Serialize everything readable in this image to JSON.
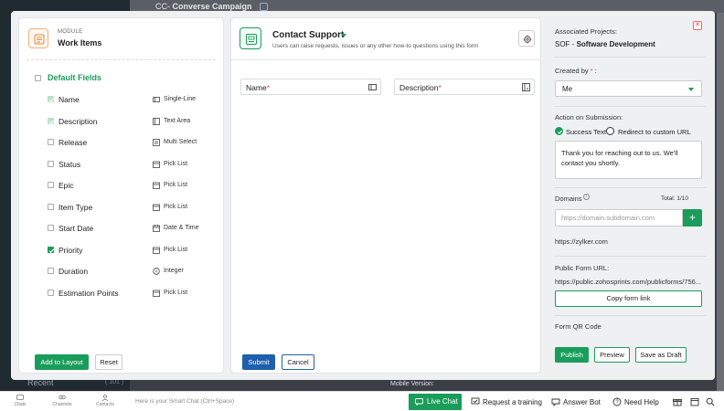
{
  "background": {
    "breadcrumb_prefix": "CC-",
    "breadcrumb_title": "Converse Campaign",
    "recent_label": "Recent",
    "recent_count": "( 101 )",
    "mobile_version": "Mobile Version:"
  },
  "module": {
    "label": "MODULE",
    "title": "Work Items",
    "default_fields_label": "Default Fields",
    "fields": [
      {
        "name": "Name",
        "type": "Single-Line",
        "state": "checked-light",
        "icon": "single-line-icon"
      },
      {
        "name": "Description",
        "type": "Text Area",
        "state": "checked-light",
        "icon": "text-area-icon"
      },
      {
        "name": "Release",
        "type": "Multi Select",
        "state": "unchecked",
        "icon": "multi-select-icon"
      },
      {
        "name": "Status",
        "type": "Pick List",
        "state": "unchecked",
        "icon": "pick-list-icon"
      },
      {
        "name": "Epic",
        "type": "Pick List",
        "state": "unchecked",
        "icon": "pick-list-icon"
      },
      {
        "name": "Item Type",
        "type": "Pick List",
        "state": "unchecked",
        "icon": "pick-list-icon"
      },
      {
        "name": "Start Date",
        "type": "Date & Time",
        "state": "unchecked",
        "icon": "date-time-icon"
      },
      {
        "name": "Priority",
        "type": "Pick List",
        "state": "checked",
        "icon": "pick-list-icon"
      },
      {
        "name": "Duration",
        "type": "Integer",
        "state": "unchecked",
        "icon": "integer-icon"
      },
      {
        "name": "Estimation Points",
        "type": "Pick List",
        "state": "unchecked",
        "icon": "pick-list-icon"
      }
    ],
    "add_to_layout_label": "Add to Layout",
    "reset_label": "Reset"
  },
  "form": {
    "title": "Contact Support",
    "subtitle": "Users can raise requests, issues or any other how-to questions using this form",
    "fields": [
      {
        "label": "Name",
        "required": "*"
      },
      {
        "label": "Description",
        "required": "*"
      }
    ],
    "submit_label": "Submit",
    "cancel_label": "Cancel"
  },
  "settings": {
    "associated_projects_label": "Associated Projects:",
    "project_code": "SOF",
    "project_separator": " - ",
    "project_name": "Software Development",
    "created_by_label": "Created by",
    "created_by_required": "*",
    "created_by_suffix": " :",
    "created_by_value": "Me",
    "action_label": "Action on Submission:",
    "option_success": "Success Text",
    "option_redirect": "Redirect to custom URL",
    "success_message": "Thank you for reaching out to us. We'll contact you shortly.",
    "domains_label": "Domains",
    "domains_total": "Total: 1/10",
    "domain_placeholder": "https://domain.subdomain.com",
    "domain_added": "https://zylker.com",
    "public_url_label": "Public Form URL:",
    "public_url": "https://public.zohosprints.com/publicforms/756...",
    "copy_link_label": "Copy form link",
    "qr_label": "Form QR Code",
    "publish_label": "Publish",
    "preview_label": "Preview",
    "save_draft_label": "Save as Draft"
  },
  "bottom_bar": {
    "nav": [
      {
        "label": "Chats"
      },
      {
        "label": "Channels"
      },
      {
        "label": "Contacts"
      }
    ],
    "smart_chat_placeholder": "Here is your Smart Chat (Ctrl+Space)",
    "live_chat": "Live Chat",
    "request_training": "Request a training",
    "answer_bot": "Answer Bot",
    "need_help": "Need Help"
  },
  "colors": {
    "accent": "#1a9d5a",
    "primary_blue": "#1e5fae",
    "module_icon": "#f0b27a"
  }
}
